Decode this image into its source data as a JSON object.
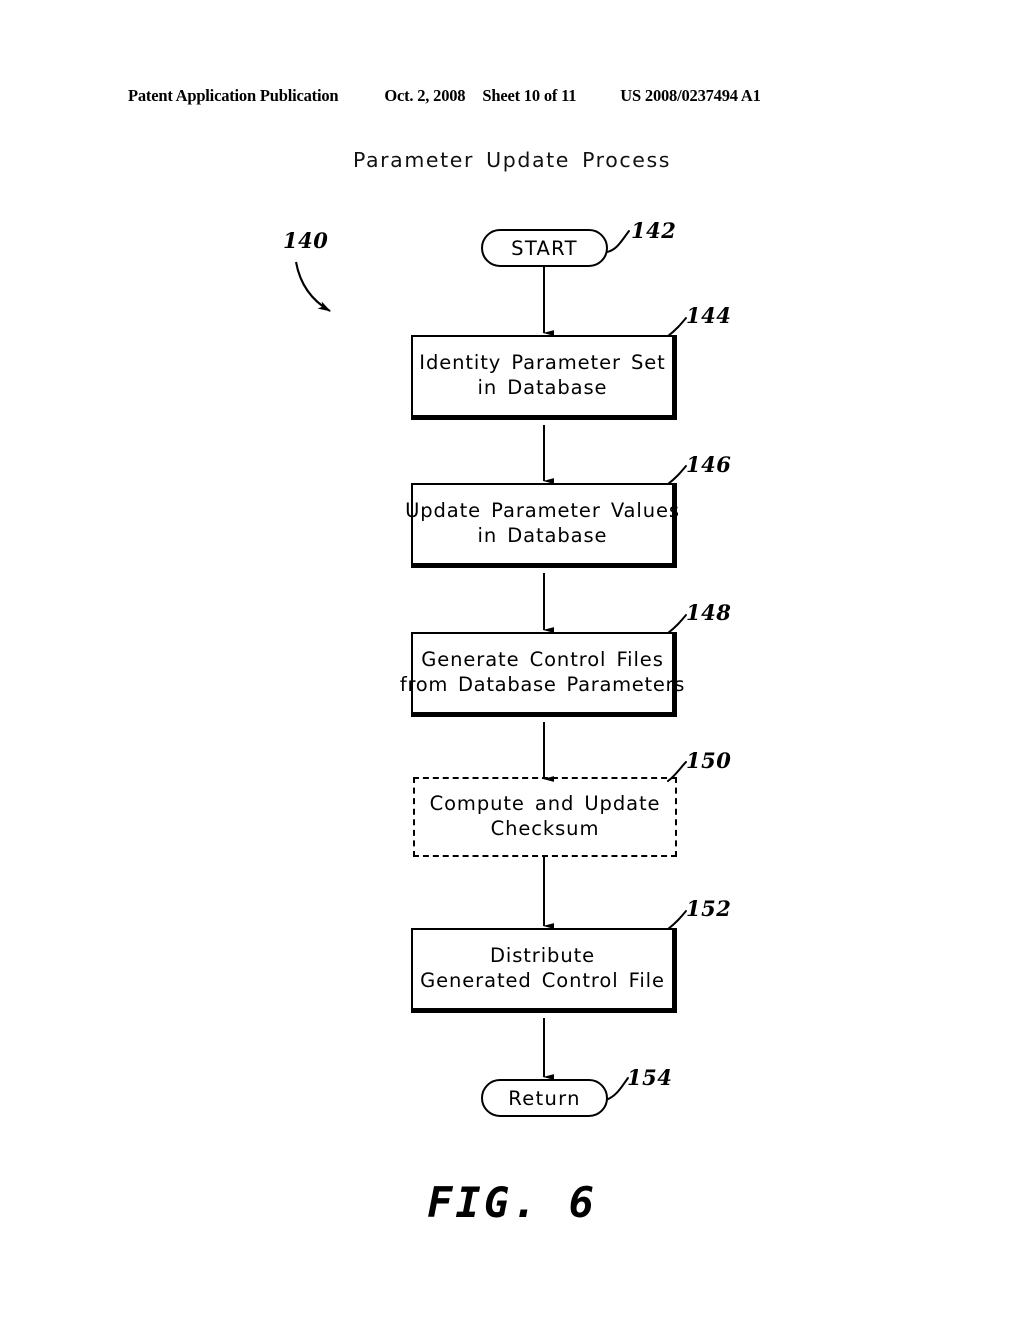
{
  "header": {
    "publication": "Patent Application Publication",
    "date": "Oct. 2, 2008",
    "sheet": "Sheet 10 of 11",
    "publication_number": "US 2008/0237494 A1"
  },
  "figure": {
    "title": "Parameter Update Process",
    "caption": "FIG. 6",
    "process_reference": "140"
  },
  "flowchart": {
    "nodes": [
      {
        "id": "start",
        "type": "terminal",
        "label": "START",
        "reference": "142"
      },
      {
        "id": "identify",
        "type": "process",
        "line1": "Identity Parameter Set",
        "line2": "in Database",
        "reference": "144",
        "optional": false
      },
      {
        "id": "update",
        "type": "process",
        "line1": "Update Parameter Values",
        "line2": "in Database",
        "reference": "146",
        "optional": false
      },
      {
        "id": "generate",
        "type": "process",
        "line1": "Generate Control Files",
        "line2": "from Database Parameters",
        "reference": "148",
        "optional": false
      },
      {
        "id": "checksum",
        "type": "process",
        "line1": "Compute and Update",
        "line2": "Checksum",
        "reference": "150",
        "optional": true
      },
      {
        "id": "distribute",
        "type": "process",
        "line1": "Distribute",
        "line2": "Generated Control File",
        "reference": "152",
        "optional": false
      },
      {
        "id": "return",
        "type": "terminal",
        "label": "Return",
        "reference": "154"
      }
    ],
    "colors": {
      "ink": "#000000",
      "paper": "#ffffff"
    }
  }
}
